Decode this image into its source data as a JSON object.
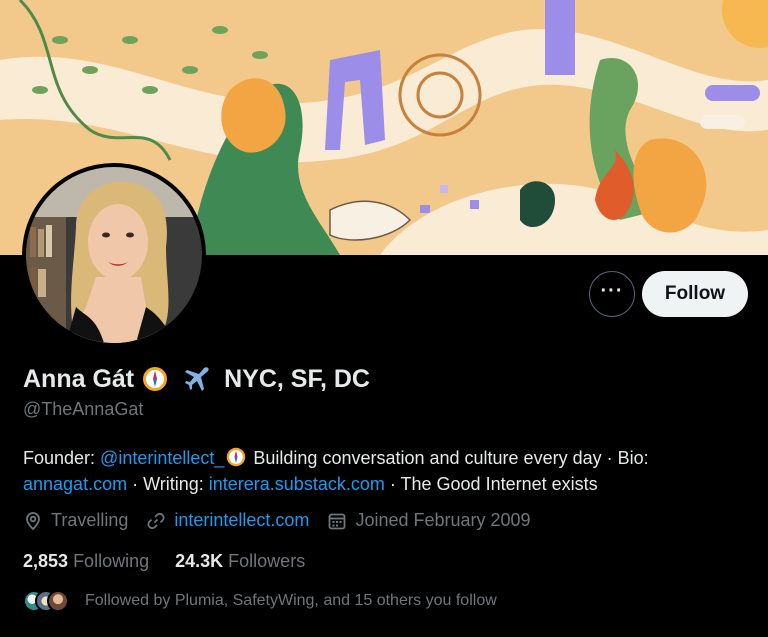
{
  "profile": {
    "name": "Anna Gát",
    "location_in_name": "NYC, SF, DC",
    "handle": "@TheAnnaGat"
  },
  "actions": {
    "more_label": "···",
    "follow_label": "Follow"
  },
  "bio": {
    "part1": "Founder: ",
    "mention": "@interintellect_",
    "part2": " Building conversation and culture every day · Bio: ",
    "link1": "annagat.com",
    "part3": " · Writing: ",
    "link2": "interera.substack.com",
    "part4": " · The Good Internet exists"
  },
  "meta": {
    "location": "Travelling",
    "website": "interintellect.com",
    "joined": "Joined February 2009"
  },
  "stats": {
    "following_count": "2,853",
    "following_label": "Following",
    "followers_count": "24.3K",
    "followers_label": "Followers"
  },
  "followed_by": {
    "text": "Followed by Plumia, SafetyWing, and 15 others you follow"
  },
  "icons": {
    "badge": "compass-icon",
    "plane": "airplane-icon",
    "location": "location-pin-icon",
    "link": "link-icon",
    "calendar": "calendar-icon"
  },
  "colors": {
    "background": "#000000",
    "text_primary": "#e7e9ea",
    "text_secondary": "#71767b",
    "link": "#1d9bf0",
    "follow_button": "#eff3f4"
  }
}
